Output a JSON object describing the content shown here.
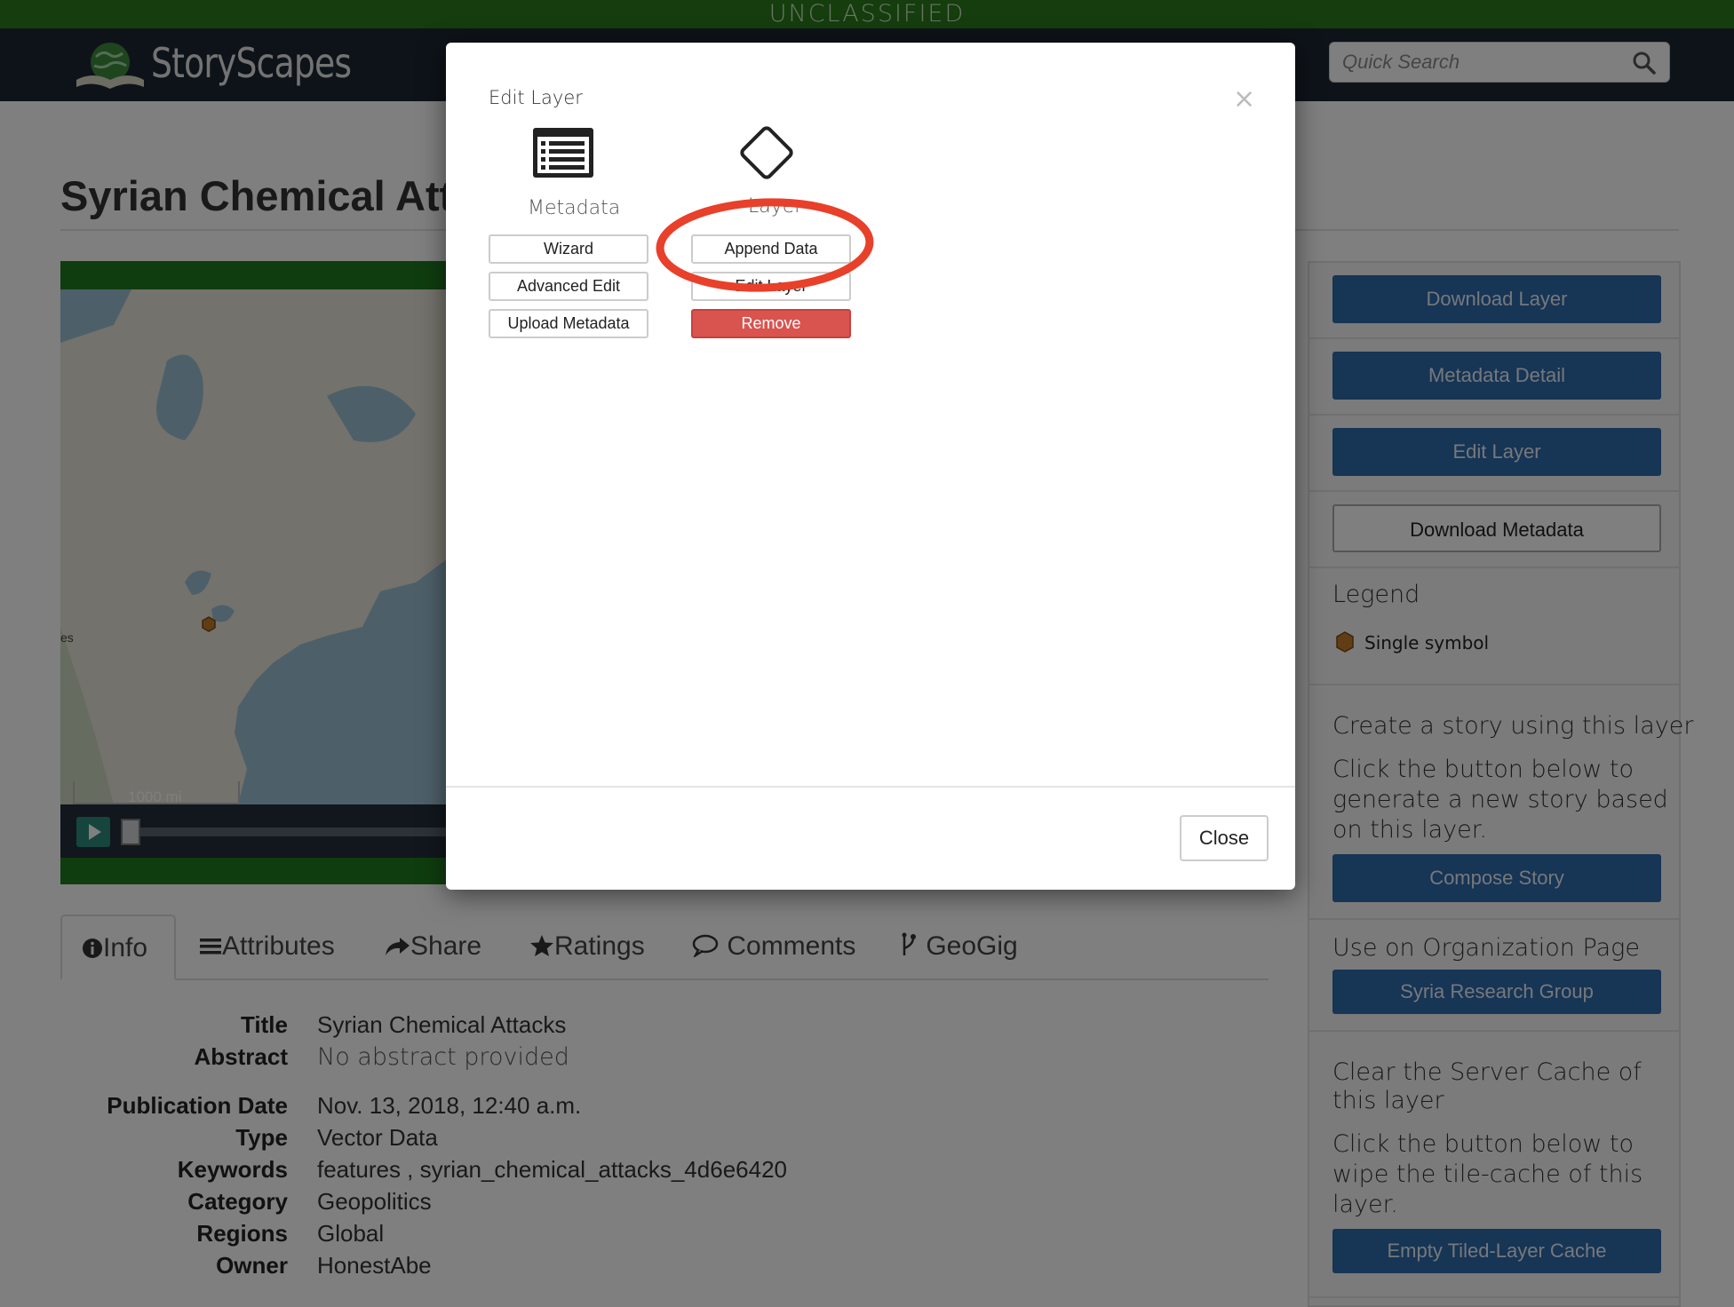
{
  "classification_banner": "UNCLASSIFIED",
  "brand": {
    "name": "StoryScapes"
  },
  "search": {
    "placeholder": "Quick Search"
  },
  "page": {
    "title": "Syrian Chemical Atta"
  },
  "map": {
    "scale_label": "1000 mi",
    "edge_label": "es"
  },
  "tabs": [
    {
      "label": "Info",
      "icon": "info-circle-icon"
    },
    {
      "label": "Attributes",
      "icon": "list-icon"
    },
    {
      "label": "Share",
      "icon": "share-icon"
    },
    {
      "label": "Ratings",
      "icon": "star-icon"
    },
    {
      "label": "Comments",
      "icon": "comment-icon"
    },
    {
      "label": "GeoGig",
      "icon": "branch-icon"
    }
  ],
  "info": {
    "title_key": "Title",
    "title_val": "Syrian Chemical Attacks",
    "abstract_key": "Abstract",
    "abstract_val": "No abstract provided",
    "pubdate_key": "Publication Date",
    "pubdate_val": "Nov. 13, 2018, 12:40 a.m.",
    "type_key": "Type",
    "type_val": "Vector Data",
    "keywords_key": "Keywords",
    "keywords_val": "features , syrian_chemical_attacks_4d6e6420",
    "category_key": "Category",
    "category_val": "Geopolitics",
    "regions_key": "Regions",
    "regions_val": "Global",
    "owner_key": "Owner",
    "owner_val": "HonestAbe"
  },
  "sidebar": {
    "download_layer": "Download Layer",
    "metadata_detail": "Metadata Detail",
    "edit_layer": "Edit Layer",
    "download_metadata": "Download Metadata",
    "legend_heading": "Legend",
    "legend_item": "Single symbol",
    "story_heading": "Create a story using this layer",
    "story_text": "Click the button below to generate a new story based on this layer.",
    "compose_story": "Compose Story",
    "org_heading": "Use on Organization Page",
    "org_button": "Syria Research Group",
    "cache_heading": "Clear the Server Cache of this layer",
    "cache_text": "Click the button below to wipe the tile-cache of this layer.",
    "cache_button": "Empty Tiled-Layer Cache"
  },
  "modal": {
    "title": "Edit Layer",
    "close_x": "×",
    "metadata_label": "Metadata",
    "layer_label": "Layer",
    "wizard": "Wizard",
    "advanced_edit": "Advanced Edit",
    "upload_metadata": "Upload Metadata",
    "append_data": "Append Data",
    "edit_layer": "Edit Layer",
    "remove": "Remove",
    "close": "Close"
  },
  "colors": {
    "classification_green": "#2a7a1a",
    "navbar": "#1c2733",
    "primary_button": "#2e6aab",
    "danger_button": "#d9534f",
    "annotation_ring": "#e8402a",
    "legend_symbol": "#c07a2a"
  }
}
